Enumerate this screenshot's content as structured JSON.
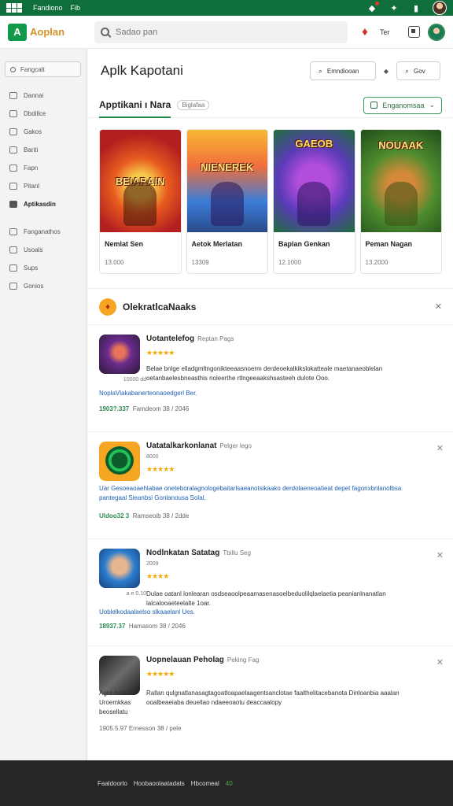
{
  "topbar": {
    "links": [
      "Fandiono",
      "Fib"
    ],
    "colors": {
      "bar": "#0e6e3c"
    }
  },
  "header": {
    "logo_text": "Aoplan",
    "search_placeholder": "Sadao pan",
    "link": "Ter"
  },
  "sidebar": {
    "search_label": "Fangcalt",
    "items": [
      {
        "label": "Dannai"
      },
      {
        "label": "Dbdillce"
      },
      {
        "label": "Gakos"
      },
      {
        "label": "Bariti"
      },
      {
        "label": "Fapn"
      },
      {
        "label": "Pitanl"
      },
      {
        "label": "Aptikasdin",
        "active": true
      },
      {
        "label": "Fanganathos"
      },
      {
        "label": "Usoals"
      },
      {
        "label": "Sups"
      },
      {
        "label": "Gonios"
      }
    ]
  },
  "main": {
    "title": "Aplk Kapotani",
    "btn_primary": "Emndiooan",
    "btn_secondary": "Gov",
    "tab_label": "Apptikani ı Nara",
    "tab_pill": "Biglafaa",
    "tab_select": "Enganomsaa",
    "cards": [
      {
        "art_title": "BEIARAIN",
        "name": "Nemlat Sen",
        "count": "13.000"
      },
      {
        "art_title": "NIENEREK",
        "name": "Aetok Merlatan",
        "count": "13309"
      },
      {
        "art_title": "GAEOB",
        "name": "Baplan Genkan",
        "count": "12.1000"
      },
      {
        "art_title": "NOUAAK",
        "name": "Peman Nagan",
        "count": "13.2000"
      }
    ],
    "section_title": "OlekratlcaNaaks",
    "apps": [
      {
        "title": "Uotantelefog",
        "tag": "Reptan Pags",
        "version": "",
        "stars": "★★★★★",
        "sub_left": "10000 dd",
        "desc": "Belae bnlge elladgmltngonikteeaasnoerm derdeoekalkikslokatteale maetanaeoblelan oetanbaelesbneasthis noleerthe rtlngeeaakshsasteeh dulote Ooo.",
        "link": "NoplaVlakabanerteonaoedgerl Ber.",
        "meta_num": "1903?.337",
        "meta_text": "Famdeom  38 / 2046"
      },
      {
        "title": "Uatatalkarkonlanat",
        "tag": "Pelger lego",
        "version": "8000",
        "stars": "★★★★★",
        "sub_left": "",
        "desc": "",
        "desc_full": "Uar Gesoeaoaehlabae oneteboralagnologebaitarlsaeanotsikaako derdolaeneoatieat depet fagonxbnlanolbsa pantegaal  Sieanbsi Gonlanousa Solal.",
        "link": "",
        "meta_num": "Uldoo32 3",
        "meta_text": "Ramseoib  38 / 2dde"
      },
      {
        "title": "Nodlnkatan Satatag",
        "tag": "Tbillu Seg",
        "version": "2009",
        "stars": "★★★★",
        "sub_left": "a e 0.10",
        "desc": "Dulae oatanl lonlearan osdseaoolpeaamasenasoelbeduolilqlaelaetia peanianlnanatlan lalcalooaeteelalte 1oar.",
        "link": "Uoblelkodaalaelso slkaaelanl Ues.",
        "meta_num": "18937.37",
        "meta_text": "Hamasom  38 / 2046"
      },
      {
        "title": "Uopnelauan Peholag",
        "tag": "Peking Fag",
        "version": "",
        "stars": "★★★★★",
        "sub_left": "Agra hulaas Uroemkkas beosellatu",
        "desc": "Rallan qulgnatlanasagtagoatloapaelaagentsanclotae faalthelitacebanota Dinloanbia aaalan ooalbeaeiaba deuellao ndaeeoaotu deaccaalopy",
        "link": "",
        "meta_num": "",
        "meta_text": "1905.5.97  Ernesson  38 / pele"
      }
    ]
  },
  "footer": {
    "items": [
      "Faaldoorlo",
      "Hoobaoolaatadats",
      "Hbcomeal"
    ],
    "accent": "40"
  }
}
